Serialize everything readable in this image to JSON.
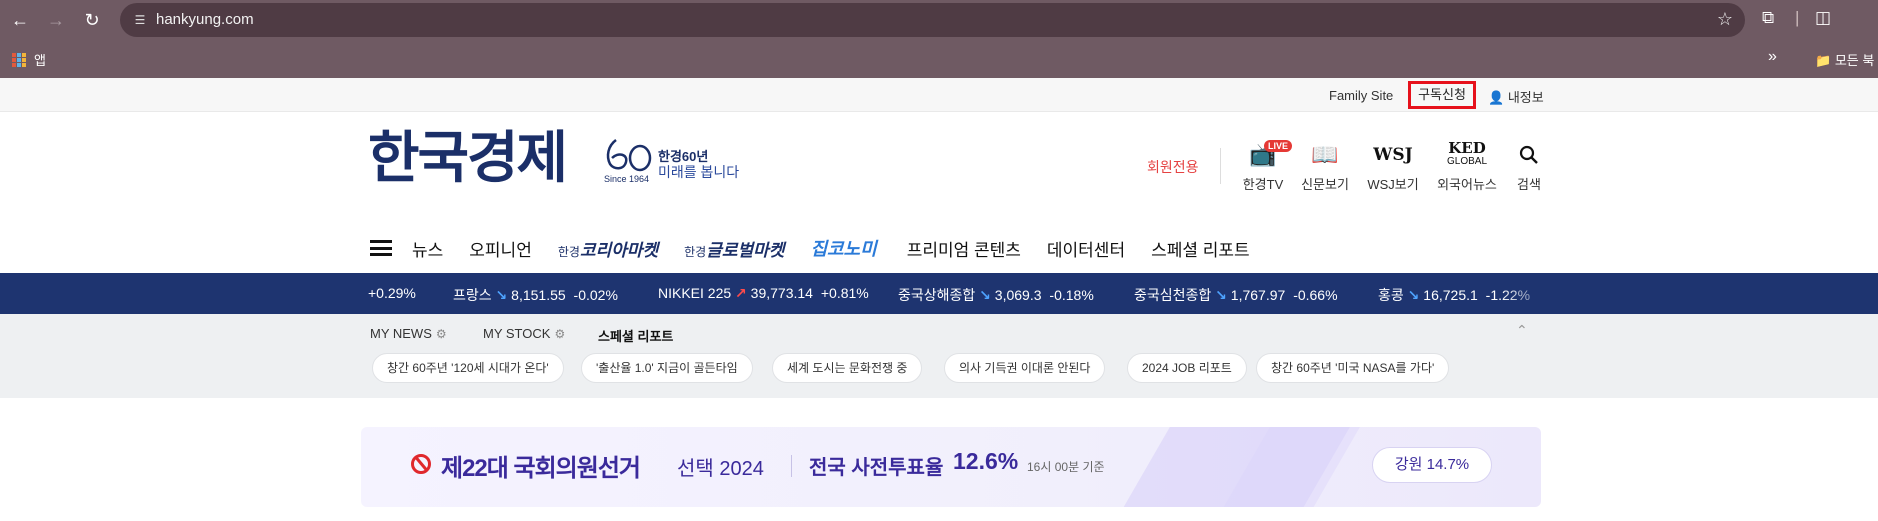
{
  "browser": {
    "url": "hankyung.com",
    "bookmarks": {
      "apps_label": "앱",
      "all_bookmarks_label": "모든 북"
    }
  },
  "util_bar": {
    "family_site": "Family Site",
    "subscribe": "구독신청",
    "my_info": "내정보"
  },
  "header": {
    "logo_text": "한국경제",
    "logo_60_title": "한경60년",
    "logo_60_sub": "미래를 봅니다",
    "logo_since": "Since 1964",
    "members_only": "회원전용",
    "icons": [
      {
        "label": "한경TV",
        "badge": "LIVE",
        "icon": "tv-icon"
      },
      {
        "label": "신문보기",
        "icon": "newspaper-icon"
      },
      {
        "label": "WSJ보기",
        "glyph": "WSJ",
        "icon": "wsj-icon"
      },
      {
        "label": "외국어뉴스",
        "glyph": "KED",
        "glyph_sub": "GLOBAL",
        "icon": "ked-global-icon"
      },
      {
        "label": "검색",
        "icon": "search-icon"
      }
    ]
  },
  "nav": {
    "items": [
      "뉴스",
      "오피니언"
    ],
    "brand1_prefix": "한경",
    "brand1": "코리아마켓",
    "brand2_prefix": "한경",
    "brand2": "글로벌마켓",
    "brand3": "집코노미",
    "items2": [
      "프리미엄 콘텐츠",
      "데이터센터",
      "스페셜 리포트"
    ]
  },
  "ticker": [
    {
      "name": "",
      "dir": "",
      "value": "",
      "change": "+0.29%"
    },
    {
      "name": "프랑스",
      "dir": "down",
      "value": "8,151.55",
      "change": "-0.02%"
    },
    {
      "name": "NIKKEI 225",
      "dir": "up",
      "value": "39,773.14",
      "change": "+0.81%"
    },
    {
      "name": "중국상해종합",
      "dir": "down",
      "value": "3,069.3",
      "change": "-0.18%"
    },
    {
      "name": "중국심천종합",
      "dir": "down",
      "value": "1,767.97",
      "change": "-0.66%"
    },
    {
      "name": "홍콩",
      "dir": "down",
      "value": "16,725.1",
      "change": "-1.22%"
    }
  ],
  "mynews": {
    "tabs": [
      "MY NEWS",
      "MY STOCK",
      "스페셜 리포트"
    ],
    "chips": [
      "창간 60주년 '120세 시대가 온다'",
      "'출산율 1.0' 지금이 골든타임",
      "세계 도시는 문화전쟁 중",
      "의사 기득권 이대론 안된다",
      "2024 JOB 리포트",
      "창간 60주년 '미국 NASA를 가다'"
    ]
  },
  "banner": {
    "title": "제22대 국회의원선거",
    "subtitle": "선택 2024",
    "label": "전국 사전투표율",
    "percent": "12.6%",
    "time": "16시 00분 기준",
    "region_pill": "강원 14.7%"
  },
  "colors": {
    "brand_navy": "#1b2f68",
    "ticker_bg": "#1e3470",
    "highlight_red": "#e6111b",
    "election_purple": "#3a2a9b"
  }
}
